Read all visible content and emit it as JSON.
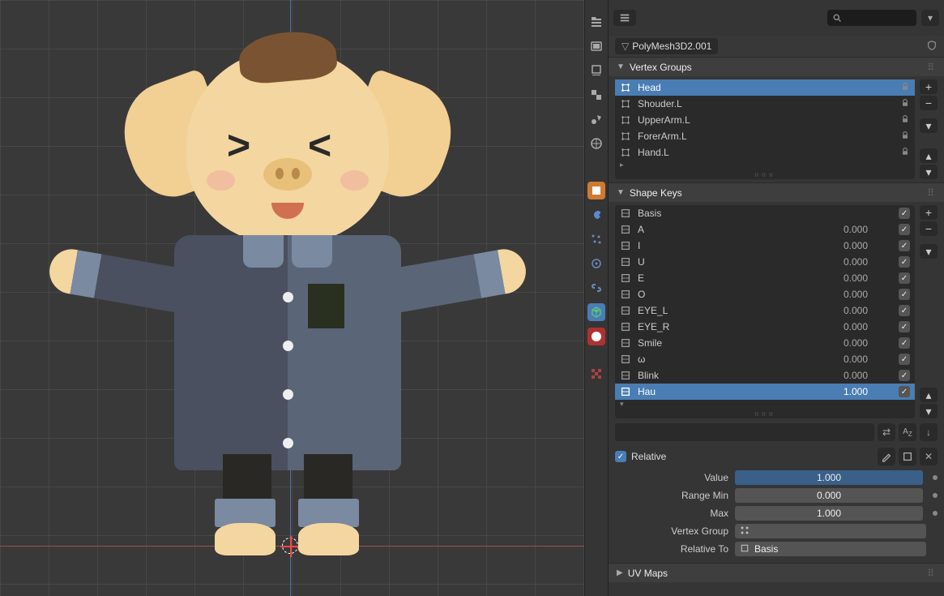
{
  "breadcrumb": {
    "object_name": "PolyMesh3D2.001"
  },
  "search": {
    "placeholder": ""
  },
  "vertex_groups": {
    "title": "Vertex Groups",
    "items": [
      {
        "name": "Head",
        "selected": true
      },
      {
        "name": "Shouder.L",
        "selected": false
      },
      {
        "name": "UpperArm.L",
        "selected": false
      },
      {
        "name": "ForerArm.L",
        "selected": false
      },
      {
        "name": "Hand.L",
        "selected": false
      }
    ]
  },
  "shape_keys": {
    "title": "Shape Keys",
    "items": [
      {
        "name": "Basis",
        "value": "",
        "selected": false
      },
      {
        "name": "A",
        "value": "0.000",
        "selected": false
      },
      {
        "name": "I",
        "value": "0.000",
        "selected": false
      },
      {
        "name": "U",
        "value": "0.000",
        "selected": false
      },
      {
        "name": "E",
        "value": "0.000",
        "selected": false
      },
      {
        "name": "O",
        "value": "0.000",
        "selected": false
      },
      {
        "name": "EYE_L",
        "value": "0.000",
        "selected": false
      },
      {
        "name": "EYE_R",
        "value": "0.000",
        "selected": false
      },
      {
        "name": "Smile",
        "value": "0.000",
        "selected": false
      },
      {
        "name": "ω",
        "value": "0.000",
        "selected": false
      },
      {
        "name": "Blink",
        "value": "0.000",
        "selected": false
      },
      {
        "name": "Hau",
        "value": "1.000",
        "selected": true
      }
    ],
    "relative_label": "Relative",
    "relative_checked": true,
    "props": {
      "value_label": "Value",
      "value_val": "1.000",
      "range_min_label": "Range Min",
      "range_min_val": "0.000",
      "max_label": "Max",
      "max_val": "1.000",
      "vertex_group_label": "Vertex Group",
      "vertex_group_val": "",
      "relative_to_label": "Relative To",
      "relative_to_val": "Basis"
    }
  },
  "uv_maps": {
    "title": "UV Maps"
  }
}
